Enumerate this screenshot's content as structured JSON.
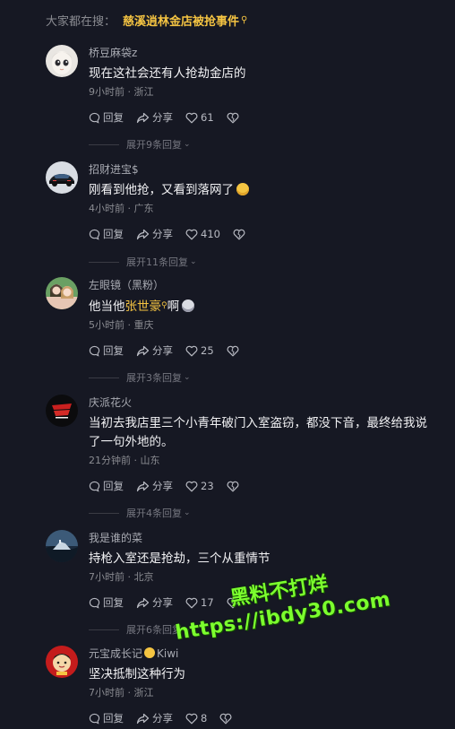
{
  "search": {
    "prefix": "大家都在搜：",
    "query": "慈溪逍林金店被抢事件"
  },
  "comments": [
    {
      "username": "桥豆麻袋z",
      "text": "现在这社会还有人抢劫金店的",
      "meta": "9小时前 · 浙江",
      "reply_label": "回复",
      "share_label": "分享",
      "likes": "61",
      "expand_label": "展开9条回复"
    },
    {
      "username": "招财进宝$",
      "text": "刚看到他抢，又看到落网了",
      "meta": "4小时前 · 广东",
      "reply_label": "回复",
      "share_label": "分享",
      "likes": "410",
      "expand_label": "展开11条回复"
    },
    {
      "username": "左眼镜（黑粉）",
      "text_prefix": "他当他",
      "text_highlight": "张世豪",
      "text_suffix": "啊",
      "meta": "5小时前 · 重庆",
      "reply_label": "回复",
      "share_label": "分享",
      "likes": "25",
      "expand_label": "展开3条回复"
    },
    {
      "username": "庆派花火",
      "text": "当初去我店里三个小青年破门入室盗窃，都没下音，最终给我说了一句外地的。",
      "meta": "21分钟前 · 山东",
      "reply_label": "回复",
      "share_label": "分享",
      "likes": "23",
      "expand_label": "展开4条回复"
    },
    {
      "username": "我是谁的菜",
      "text": "持枪入室还是抢劫，三个从重情节",
      "meta": "7小时前 · 北京",
      "reply_label": "回复",
      "share_label": "分享",
      "likes": "17",
      "expand_label": "展开6条回复"
    },
    {
      "username": "元宝成长记",
      "username_suffix": "Kiwi",
      "text": "坚决抵制这种行为",
      "meta": "7小时前 · 浙江",
      "reply_label": "回复",
      "share_label": "分享",
      "likes": "8"
    }
  ],
  "watermark": {
    "line1": "黑料不打烊",
    "line2": "https://ibdy30.com"
  },
  "colors": {
    "background": "#161823",
    "highlight": "#f5c442",
    "watermark": "#7cff2e"
  }
}
